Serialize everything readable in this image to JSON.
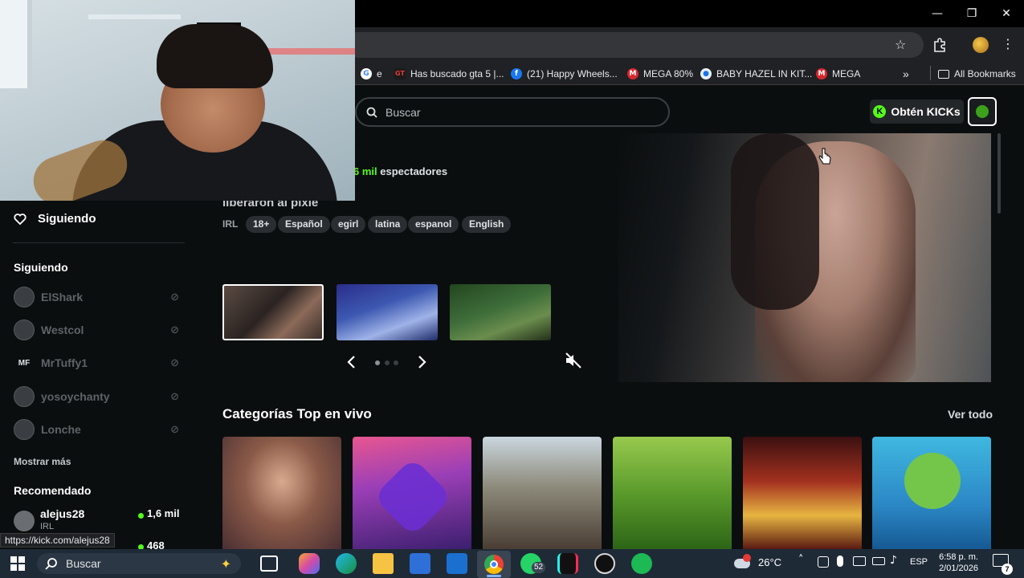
{
  "bookmarks": [
    {
      "label": "e",
      "icon": "google-icon"
    },
    {
      "label": "Has buscado gta 5 |...",
      "icon": "gt-icon"
    },
    {
      "label": "(21) Happy Wheels...",
      "icon": "facebook-icon"
    },
    {
      "label": "MEGA 80%",
      "icon": "mega-icon"
    },
    {
      "label": "BABY HAZEL IN KIT...",
      "icon": "globe-icon"
    },
    {
      "label": "MEGA",
      "icon": "mega-icon"
    }
  ],
  "bookmarks_more": "»",
  "all_bookmarks": "All Bookmarks",
  "search": {
    "placeholder": "Buscar"
  },
  "kicks_button": "Obtén KICKs",
  "featured": {
    "viewers_count": "6 mil",
    "viewers_label": "espectadores",
    "title": "liberaron al pixie",
    "category": "IRL",
    "tags": [
      "18+",
      "Español",
      "egirl",
      "latina",
      "espanol",
      "English"
    ]
  },
  "sidebar": {
    "following_header": "Siguiendo",
    "following_section": "Siguiendo",
    "channels": [
      {
        "name": "ElShark"
      },
      {
        "name": "Westcol"
      },
      {
        "name": "MrTuffy1",
        "initials": "MF"
      },
      {
        "name": "yosoychanty"
      },
      {
        "name": "Lonche"
      }
    ],
    "show_more": "Mostrar más",
    "recommended_section": "Recomendado",
    "recommended": [
      {
        "name": "alejus28",
        "category": "IRL",
        "viewers": "1,6 mil"
      },
      {
        "viewers": "468"
      }
    ]
  },
  "categories": {
    "title": "Categorías Top en vivo",
    "see_all": "Ver todo"
  },
  "status_url": "https://kick.com/alejus28",
  "taskbar": {
    "search_placeholder": "Buscar",
    "whatsapp_badge": "52",
    "temperature": "26°C",
    "language": "ESP",
    "time": "6:58 p. m.",
    "date": "2/01/2026",
    "notification_count": "7"
  },
  "colors": {
    "kick_green": "#53fc18",
    "background": "#0b0e0f",
    "tag_bg": "#2a2e32"
  }
}
